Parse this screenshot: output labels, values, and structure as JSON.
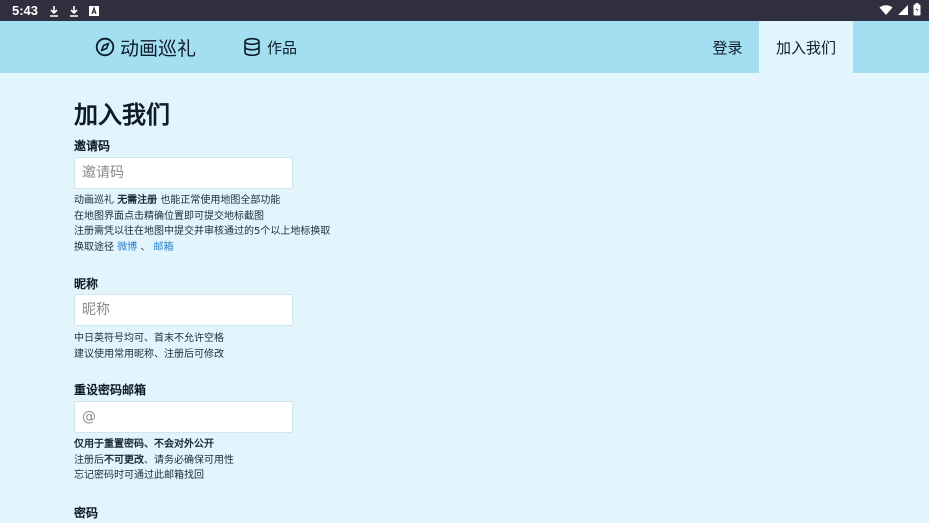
{
  "status": {
    "time": "5:43"
  },
  "nav": {
    "brand": "动画巡礼",
    "works": "作品",
    "login": "登录",
    "join": "加入我们"
  },
  "page": {
    "title": "加入我们",
    "invite": {
      "label": "邀请码",
      "placeholder": "邀请码",
      "help": {
        "l1_a": "动画巡礼 ",
        "l1_b": "无需注册",
        "l1_c": " 也能正常使用地图全部功能",
        "l2": "在地图界面点击精确位置即可提交地标截图",
        "l3": "注册需凭以往在地图中提交并审核通过的5个以上地标换取",
        "l4_a": "换取途径 ",
        "l4_weibo": "微博",
        "l4_sep": " 、 ",
        "l4_mail": "邮箱"
      }
    },
    "nickname": {
      "label": "昵称",
      "placeholder": "昵称",
      "help": {
        "l1": "中日英符号均可、首末不允许空格",
        "l2": "建议使用常用昵称、注册后可修改"
      }
    },
    "email": {
      "label": "重设密码邮箱",
      "placeholder": "@",
      "help": {
        "l1": "仅用于重置密码、不会对外公开",
        "l2_a": "注册后",
        "l2_b": "不可更改",
        "l2_c": "、请务必确保可用性",
        "l3": "忘记密码时可通过此邮箱找回"
      }
    },
    "password": {
      "label": "密码"
    }
  }
}
